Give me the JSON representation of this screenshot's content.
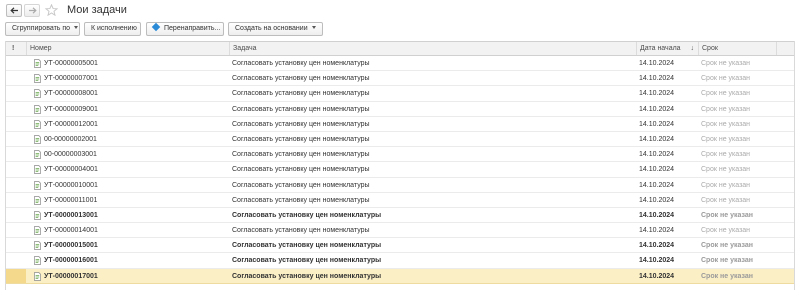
{
  "window": {
    "title": "Мои задачи",
    "nav_back_icon": "arrow-left-icon",
    "nav_forward_icon": "arrow-right-icon",
    "favorite_icon": "star-icon"
  },
  "toolbar": {
    "group_label": "Сгруппировать по",
    "execute_label": "К исполнению",
    "redirect_label": "Перенаправить...",
    "create_label": "Создать на основании"
  },
  "columns": {
    "flag": "!",
    "number": "Номер",
    "task": "Задача",
    "start_date": "Дата начала",
    "deadline": "Срок"
  },
  "rows": [
    {
      "number": "УТ-00000005001",
      "task": "Согласовать установку цен номенклатуры",
      "date": "14.10.2024",
      "deadline": "Срок не указан",
      "bold": false
    },
    {
      "number": "УТ-00000007001",
      "task": "Согласовать установку цен номенклатуры",
      "date": "14.10.2024",
      "deadline": "Срок не указан",
      "bold": false
    },
    {
      "number": "УТ-00000008001",
      "task": "Согласовать установку цен номенклатуры",
      "date": "14.10.2024",
      "deadline": "Срок не указан",
      "bold": false
    },
    {
      "number": "УТ-00000009001",
      "task": "Согласовать установку цен номенклатуры",
      "date": "14.10.2024",
      "deadline": "Срок не указан",
      "bold": false
    },
    {
      "number": "УТ-00000012001",
      "task": "Согласовать установку цен номенклатуры",
      "date": "14.10.2024",
      "deadline": "Срок не указан",
      "bold": false
    },
    {
      "number": "00-00000002001",
      "task": "Согласовать установку цен номенклатуры",
      "date": "14.10.2024",
      "deadline": "Срок не указан",
      "bold": false
    },
    {
      "number": "00-00000003001",
      "task": "Согласовать установку цен номенклатуры",
      "date": "14.10.2024",
      "deadline": "Срок не указан",
      "bold": false
    },
    {
      "number": "УТ-00000004001",
      "task": "Согласовать установку цен номенклатуры",
      "date": "14.10.2024",
      "deadline": "Срок не указан",
      "bold": false
    },
    {
      "number": "УТ-00000010001",
      "task": "Согласовать установку цен номенклатуры",
      "date": "14.10.2024",
      "deadline": "Срок не указан",
      "bold": false
    },
    {
      "number": "УТ-00000011001",
      "task": "Согласовать установку цен номенклатуры",
      "date": "14.10.2024",
      "deadline": "Срок не указан",
      "bold": false
    },
    {
      "number": "УТ-00000013001",
      "task": "Согласовать установку цен номенклатуры",
      "date": "14.10.2024",
      "deadline": "Срок не указан",
      "bold": true
    },
    {
      "number": "УТ-00000014001",
      "task": "Согласовать установку цен номенклатуры",
      "date": "14.10.2024",
      "deadline": "Срок не указан",
      "bold": false
    },
    {
      "number": "УТ-00000015001",
      "task": "Согласовать установку цен номенклатуры",
      "date": "14.10.2024",
      "deadline": "Срок не указан",
      "bold": true
    },
    {
      "number": "УТ-00000016001",
      "task": "Согласовать установку цен номенклатуры",
      "date": "14.10.2024",
      "deadline": "Срок не указан",
      "bold": true
    },
    {
      "number": "УТ-00000017001",
      "task": "Согласовать установку цен номенклатуры",
      "date": "14.10.2024",
      "deadline": "Срок не указан",
      "bold": true,
      "selected": true
    }
  ],
  "colors": {
    "selected_row": "#fbefc6",
    "deadline_text": "#aaaaaa",
    "redirect_icon": "#2b8bd6"
  }
}
